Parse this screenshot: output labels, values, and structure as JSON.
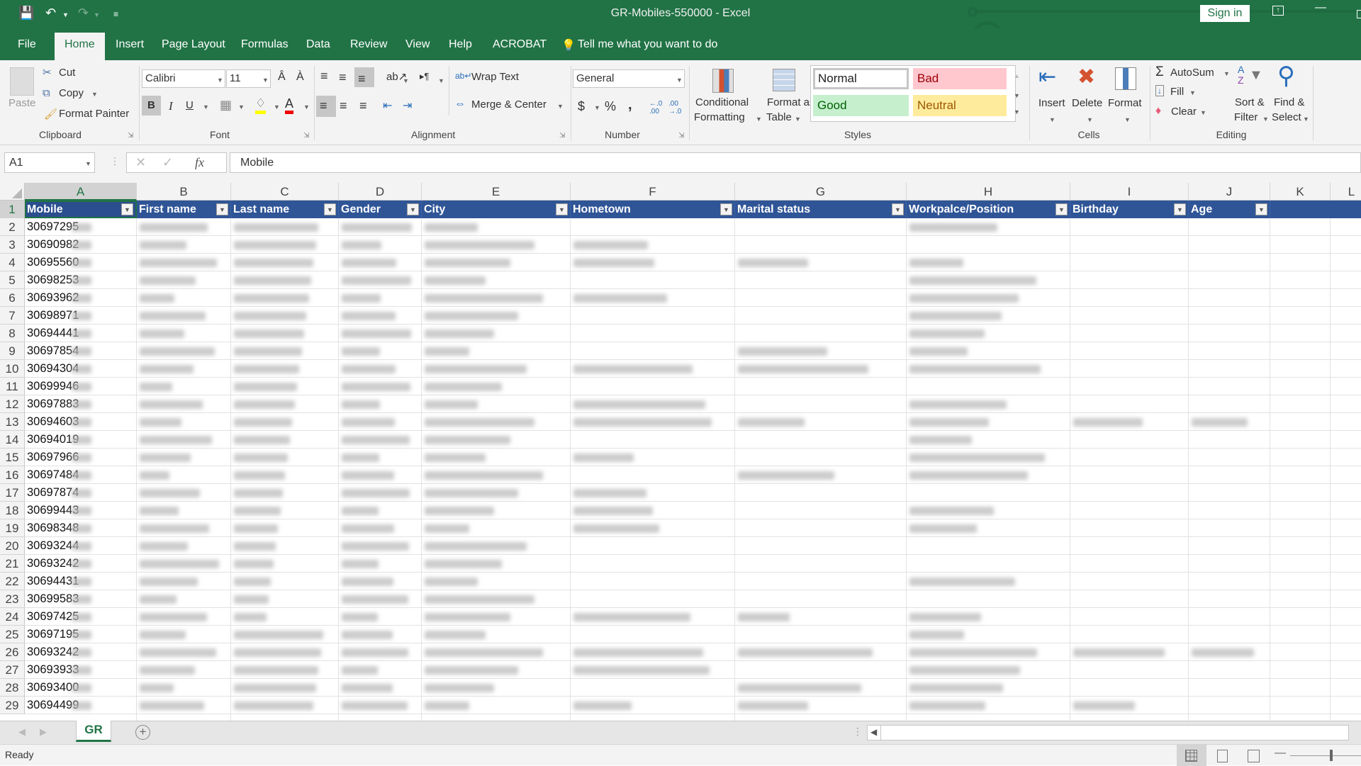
{
  "window": {
    "title": "GR-Mobiles-550000  -  Excel",
    "sign_in": "Sign in"
  },
  "menu_tabs": [
    "File",
    "Home",
    "Insert",
    "Page Layout",
    "Formulas",
    "Data",
    "Review",
    "View",
    "Help",
    "ACROBAT"
  ],
  "active_tab": "Home",
  "tell_me": "Tell me what you want to do",
  "ribbon": {
    "clipboard": {
      "paste": "Paste",
      "cut": "Cut",
      "copy": "Copy",
      "format_painter": "Format Painter",
      "label": "Clipboard"
    },
    "font": {
      "name": "Calibri",
      "size": "11",
      "bold": "B",
      "italic": "I",
      "underline": "U",
      "label": "Font"
    },
    "alignment": {
      "wrap_text": "Wrap Text",
      "merge_center": "Merge & Center",
      "label": "Alignment"
    },
    "number": {
      "format": "General",
      "currency": "$",
      "percent": "%",
      "comma": ",",
      "label": "Number"
    },
    "styles": {
      "conditional_1": "Conditional",
      "conditional_2": "Formatting",
      "format_table_1": "Format as",
      "format_table_2": "Table",
      "normal": "Normal",
      "bad": "Bad",
      "good": "Good",
      "neutral": "Neutral",
      "label": "Styles"
    },
    "cells": {
      "insert": "Insert",
      "delete": "Delete",
      "format": "Format",
      "label": "Cells"
    },
    "editing": {
      "autosum": "AutoSum",
      "fill": "Fill",
      "clear": "Clear",
      "sort_1": "Sort &",
      "sort_2": "Filter",
      "find_1": "Find &",
      "find_2": "Select",
      "label": "Editing"
    }
  },
  "formula_bar": {
    "name_box": "A1",
    "fx": "fx",
    "value": "Mobile"
  },
  "columns": [
    "A",
    "B",
    "C",
    "D",
    "E",
    "F",
    "G",
    "H",
    "I",
    "J",
    "K",
    "L"
  ],
  "headers": [
    "Mobile",
    "First name",
    "Last name",
    "Gender",
    "City",
    "Hometown",
    "Marital status",
    "Workpalce/Position",
    "Birthday",
    "Age"
  ],
  "rows": [
    {
      "n": "2",
      "mobile": "30697295"
    },
    {
      "n": "3",
      "mobile": "30690982"
    },
    {
      "n": "4",
      "mobile": "30695560"
    },
    {
      "n": "5",
      "mobile": "30698253"
    },
    {
      "n": "6",
      "mobile": "30693962"
    },
    {
      "n": "7",
      "mobile": "30698971"
    },
    {
      "n": "8",
      "mobile": "30694441"
    },
    {
      "n": "9",
      "mobile": "30697854"
    },
    {
      "n": "10",
      "mobile": "30694304"
    },
    {
      "n": "11",
      "mobile": "30699946"
    },
    {
      "n": "12",
      "mobile": "30697883"
    },
    {
      "n": "13",
      "mobile": "30694603"
    },
    {
      "n": "14",
      "mobile": "30694019"
    },
    {
      "n": "15",
      "mobile": "30697966"
    },
    {
      "n": "16",
      "mobile": "30697484"
    },
    {
      "n": "17",
      "mobile": "30697874"
    },
    {
      "n": "18",
      "mobile": "30699443"
    },
    {
      "n": "19",
      "mobile": "30698348"
    },
    {
      "n": "20",
      "mobile": "30693244"
    },
    {
      "n": "21",
      "mobile": "30693242"
    },
    {
      "n": "22",
      "mobile": "30694431"
    },
    {
      "n": "23",
      "mobile": "30699583"
    },
    {
      "n": "24",
      "mobile": "30697425"
    },
    {
      "n": "25",
      "mobile": "30697195"
    },
    {
      "n": "26",
      "mobile": "30693242"
    },
    {
      "n": "27",
      "mobile": "30693933"
    },
    {
      "n": "28",
      "mobile": "30693400"
    },
    {
      "n": "29",
      "mobile": "30694499"
    }
  ],
  "sheet_tabs": [
    "GR"
  ],
  "status": {
    "ready": "Ready"
  },
  "colors": {
    "excel_green": "#217346",
    "header_blue": "#2f5597",
    "bad_bg": "#ffc7ce",
    "bad_fg": "#9c0006",
    "good_bg": "#c6efce",
    "good_fg": "#006100",
    "neutral_bg": "#ffeb9c",
    "neutral_fg": "#9c5700"
  }
}
